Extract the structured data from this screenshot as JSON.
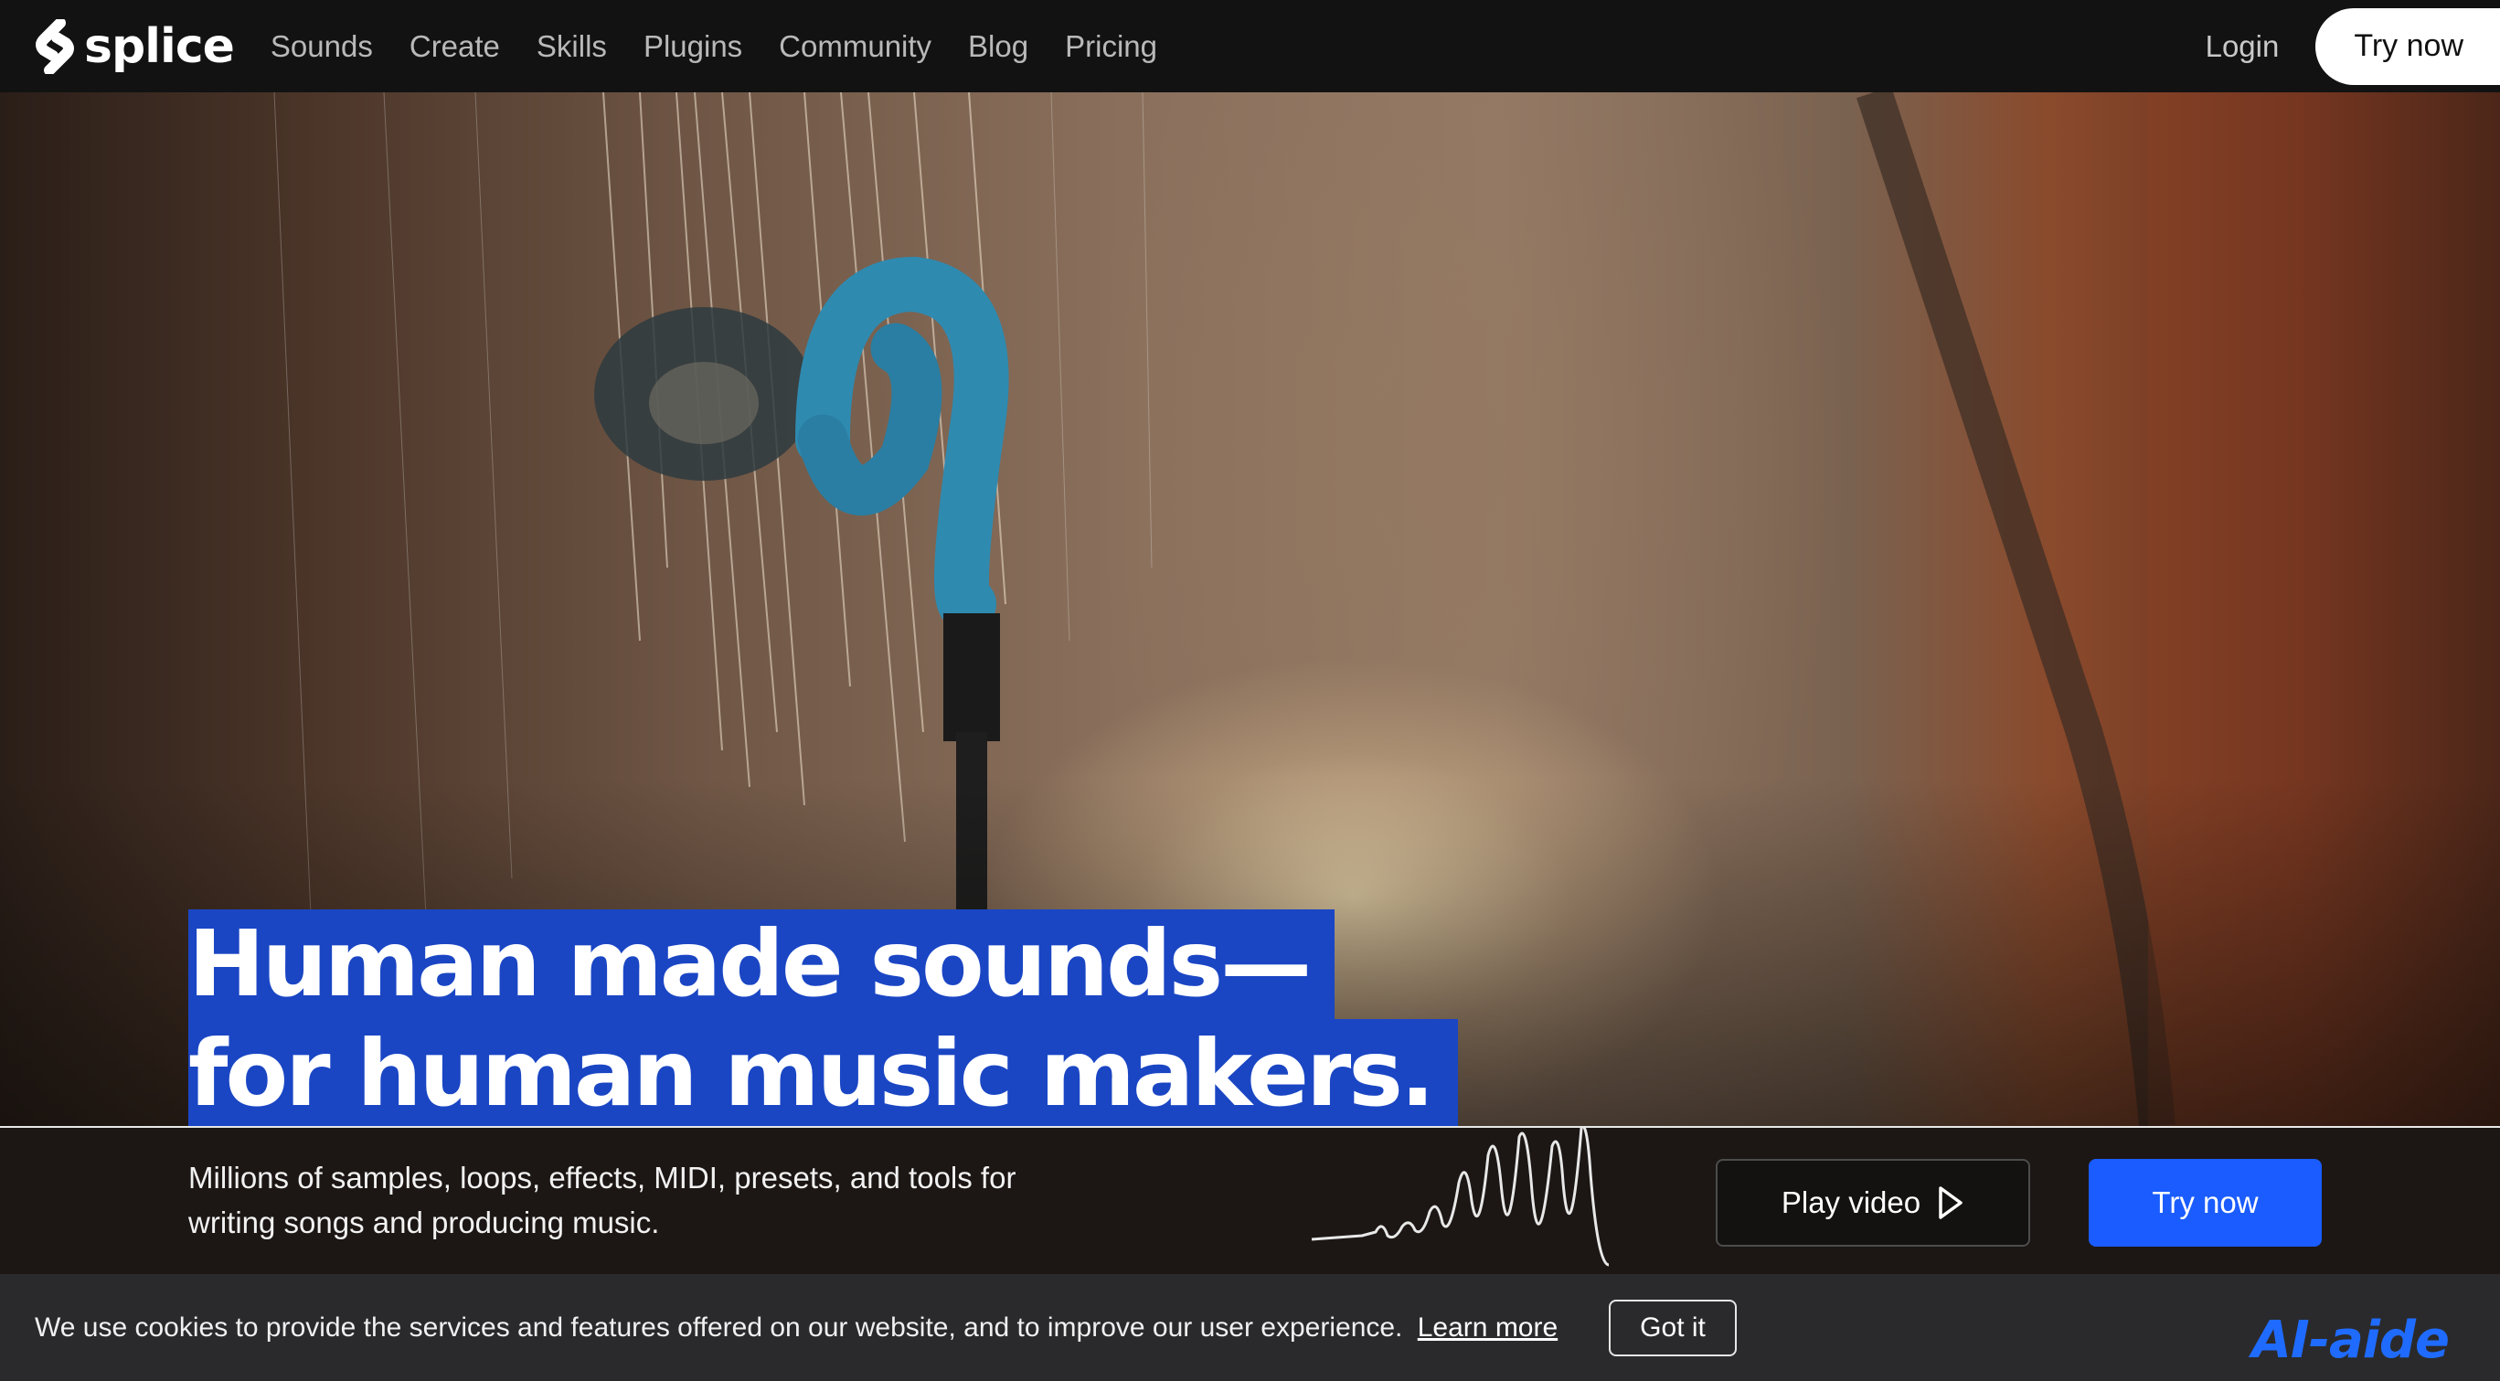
{
  "nav": {
    "brand": "splice",
    "links": [
      "Sounds",
      "Create",
      "Skills",
      "Plugins",
      "Community",
      "Blog",
      "Pricing"
    ],
    "login_label": "Login",
    "try_label": "Try now"
  },
  "hero": {
    "headline_line1": "Human made sounds—",
    "headline_line2": "for human music makers."
  },
  "strip": {
    "description": "Millions of samples, loops, effects, MIDI, presets, and tools for writing songs and producing music.",
    "play_label": "Play video",
    "try_label": "Try now"
  },
  "cookie": {
    "text": "We use cookies to provide the services and features offered on our website, and to improve our user experience.",
    "link_label": "Learn more",
    "button_label": "Got it"
  },
  "watermark": "AI-aide",
  "colors": {
    "headline_highlight": "#1a46c4",
    "cta_blue": "#1a5cff",
    "nav_bg": "#121212",
    "cookie_bg": "#2a2a2c"
  },
  "icons": [
    "splice-logo-icon",
    "play-triangle-icon"
  ]
}
